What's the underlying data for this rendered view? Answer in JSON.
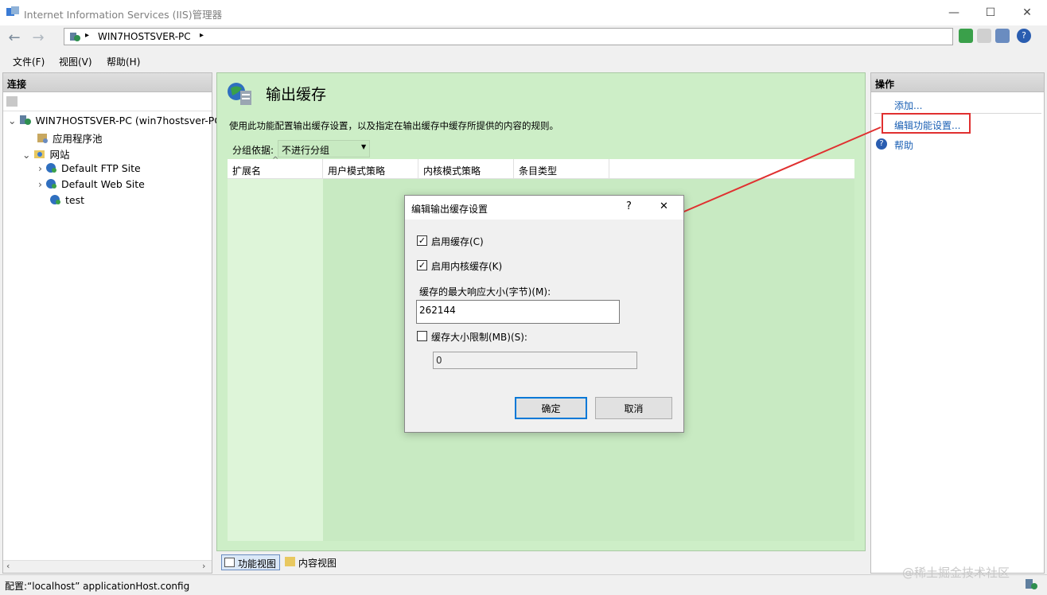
{
  "window": {
    "title": "Internet Information Services (IIS)管理器",
    "minimize": "—",
    "maximize": "☐",
    "close": "✕"
  },
  "address": {
    "crumb": "WIN7HOSTSVER-PC",
    "arrow1": "▸",
    "arrow2": "▸"
  },
  "menu": {
    "file": "文件(F)",
    "view": "视图(V)",
    "help": "帮助(H)"
  },
  "left": {
    "header": "连接",
    "tree": {
      "server": "WIN7HOSTSVER-PC (win7hostsver-PC",
      "apppools": "应用程序池",
      "sites": "网站",
      "site1": "Default FTP Site",
      "site2": "Default Web Site",
      "site3": "test"
    }
  },
  "center": {
    "title": "输出缓存",
    "description": "使用此功能配置输出缓存设置，以及指定在输出缓存中缓存所提供的内容的规则。",
    "groupby_label": "分组依据:",
    "groupby_value": "不进行分组",
    "columns": [
      "扩展名",
      "用户模式策略",
      "内核模式策略",
      "条目类型"
    ],
    "tab_feature": "功能视图",
    "tab_content": "内容视图"
  },
  "right": {
    "header": "操作",
    "add": "添加...",
    "edit": "编辑功能设置...",
    "help": "帮助"
  },
  "status": {
    "text": "配置:“localhost” applicationHost.config",
    "watermark": "@稀土掘金技术社区"
  },
  "dialog": {
    "title": "编辑输出缓存设置",
    "help_btn": "?",
    "close_btn": "✕",
    "enable_cache": "启用缓存(C)",
    "enable_kernel": "启用内核缓存(K)",
    "max_size_label": "缓存的最大响应大小(字节)(M):",
    "max_size_value": "262144",
    "limit_label": "缓存大小限制(MB)(S):",
    "limit_value": "0",
    "ok": "确定",
    "cancel": "取消"
  },
  "colors": {
    "accent_link": "#1a5fb4",
    "center_bg": "#cdeec7",
    "highlight_red": "#e03030"
  }
}
